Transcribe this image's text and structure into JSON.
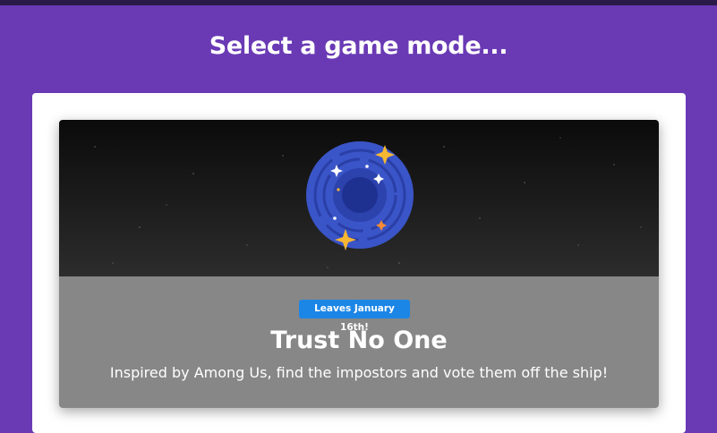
{
  "page": {
    "heading": "Select a game mode..."
  },
  "mode_card": {
    "badge": "Leaves January 16th!",
    "title": "Trust No One",
    "description": "Inspired by Among Us, find the impostors and vote them off the ship!",
    "image_icon": "spiral-galaxy-portal-icon"
  },
  "colors": {
    "background": "#6a3ab5",
    "badge": "#1c86e6",
    "card_body": "#878787",
    "portal": "#3a55c8",
    "sparkle": "#f7b733"
  }
}
